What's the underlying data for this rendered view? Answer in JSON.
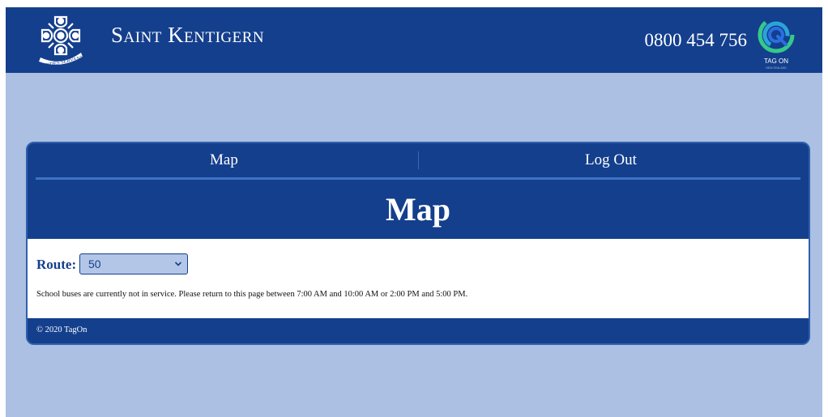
{
  "header": {
    "brand": "Saint Kentigern",
    "crest_motto": "FIDES SERVANDA EST",
    "phone": "0800 454 756",
    "partner_logo_text": "TAG ON",
    "partner_logo_subtext": "NEW ZEALAND"
  },
  "nav": {
    "items": [
      {
        "label": "Map"
      },
      {
        "label": "Log Out"
      }
    ]
  },
  "main": {
    "heading": "Map",
    "route": {
      "label": "Route:",
      "selected": "50"
    },
    "notice": "School buses are currently not in service. Please return to this page between 7:00 AM and 10:00 AM or 2:00 PM and 5:00 PM."
  },
  "footer": {
    "copyright": "© 2020 TagOn"
  },
  "colors": {
    "primary": "#143f8d",
    "page_background": "#abc0e2",
    "accent_line": "#3f72c4",
    "select_background": "#b3c6e7",
    "logo_green": "#35c98a",
    "logo_teal": "#2aa4d8",
    "logo_blue": "#2b6fe0"
  },
  "icons": {
    "crest": "celtic-cross-crest-icon",
    "partner": "tagon-q-logo-icon",
    "dropdown": "chevron-down-icon"
  }
}
